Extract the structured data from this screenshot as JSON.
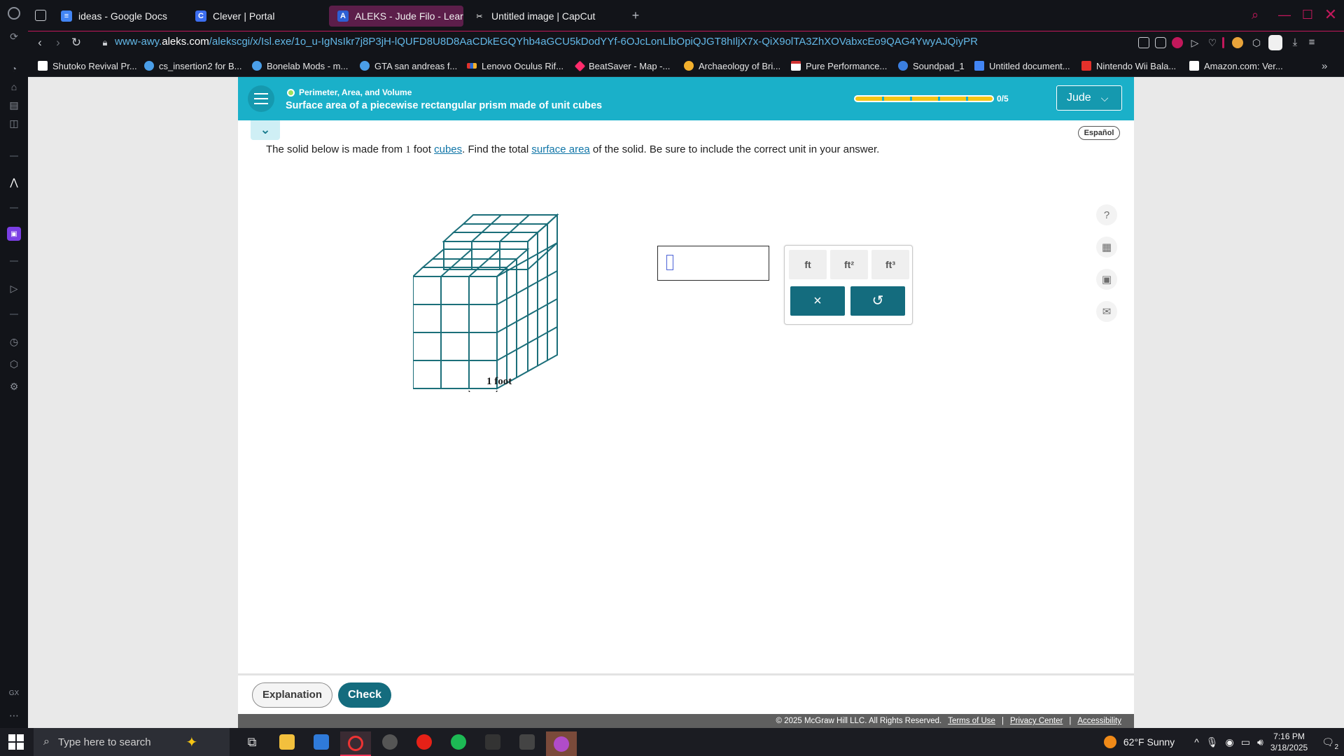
{
  "browser": {
    "tabs": [
      {
        "label": "ideas - Google Docs",
        "icon": "google-docs-icon",
        "color": "#4285f4",
        "active": false
      },
      {
        "label": "Clever | Portal",
        "icon": "clever-icon",
        "color": "#3c6ef0",
        "active": false
      },
      {
        "label": "ALEKS - Jude Filo - Learn",
        "icon": "aleks-icon",
        "color": "#5c1e4a",
        "active": true
      },
      {
        "label": "Untitled image | CapCut",
        "icon": "capcut-icon",
        "color": "#ffffff",
        "active": false
      }
    ],
    "url_prefix": "www-awy.",
    "url_domain": "aleks.com",
    "url_path": "/alekscgi/x/Isl.exe/1o_u-IgNsIkr7j8P3jH-lQUFD8U8D8AaCDkEGQYhb4aGCU5kDodYYf-6OJcLonLlbOpiQJGT8hIljX7x-QiX9olTA3ZhXOVabxcEo9QAG4YwyAJQiyPR",
    "bookmarks": [
      {
        "label": "Shutoko Revival Pr...",
        "icon": "page-icon",
        "color": "#ffffff"
      },
      {
        "label": "cs_insertion2 for B...",
        "icon": "gear-icon",
        "color": "#4a9ee8"
      },
      {
        "label": "Bonelab Mods - m...",
        "icon": "gear-icon",
        "color": "#4a9ee8"
      },
      {
        "label": "GTA san andreas f...",
        "icon": "gear-icon",
        "color": "#4a9ee8"
      },
      {
        "label": "Lenovo Oculus Rif...",
        "icon": "lenovo-icon",
        "color": "#e4312b"
      },
      {
        "label": "BeatSaver - Map -...",
        "icon": "beatsaver-icon",
        "color": "#ff2b6b"
      },
      {
        "label": "Archaeology of Bri...",
        "icon": "archaeology-icon",
        "color": "#f3b02d"
      },
      {
        "label": "Pure Performance...",
        "icon": "pure-icon",
        "color": "#d23333"
      },
      {
        "label": "Soundpad_1",
        "icon": "soundpad-icon",
        "color": "#3b7fe0"
      },
      {
        "label": "Untitled document...",
        "icon": "google-docs-icon",
        "color": "#4285f4"
      },
      {
        "label": "Nintendo Wii Bala...",
        "icon": "nintendo-icon",
        "color": "#e4312b"
      },
      {
        "label": "Amazon.com: Ver...",
        "icon": "amazon-icon",
        "color": "#ffffff"
      }
    ]
  },
  "aleks": {
    "topic": "Perimeter, Area, and Volume",
    "lesson": "Surface area of a piecewise rectangular prism made of unit cubes",
    "progress_text": "0/5",
    "progress_fraction": 0.0,
    "user": "Jude",
    "espanol": "Español",
    "problem": {
      "part1": "The solid below is made from ",
      "num": "1",
      "part2": " foot ",
      "link1": "cubes",
      "part3": ". Find the total ",
      "link2": "surface area",
      "part4": " of the solid. Be sure to include the correct unit in your answer."
    },
    "figure_label": "1 foot",
    "answer_value": "",
    "units": [
      "ft",
      "ft²",
      "ft³"
    ],
    "clear_symbol": "×",
    "undo_symbol": "↺",
    "explanation": "Explanation",
    "check": "Check",
    "footer": {
      "copyright": "© 2025 McGraw Hill LLC. All Rights Reserved.",
      "terms": "Terms of Use",
      "privacy": "Privacy Center",
      "accessibility": "Accessibility",
      "sep": "|"
    }
  },
  "taskbar": {
    "search_placeholder": "Type here to search",
    "weather": "62°F  Sunny",
    "time": "7:16 PM",
    "date": "3/18/2025",
    "notifications": "2"
  }
}
